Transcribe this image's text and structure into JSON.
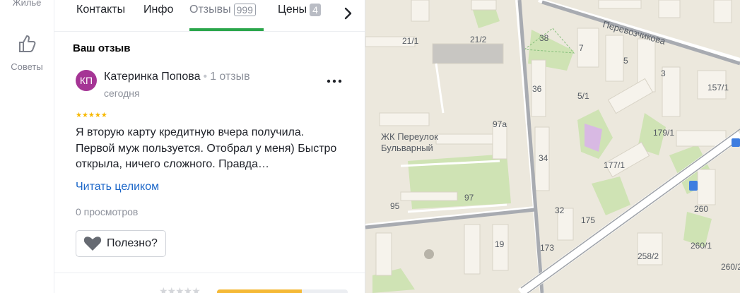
{
  "rail": {
    "items": [
      {
        "label": "Жилье",
        "icon": "home-icon"
      },
      {
        "label": "Советы",
        "icon": "thumbs-up-icon"
      }
    ]
  },
  "tabs": {
    "items": [
      {
        "label": "Контакты"
      },
      {
        "label": "Инфо"
      },
      {
        "label": "Отзывы",
        "count": "999",
        "active": true
      },
      {
        "label": "Цены",
        "count": "4"
      }
    ],
    "active_color": "#2ba64b"
  },
  "review": {
    "section_title": "Ваш отзыв",
    "avatar_initials": "КП",
    "avatar_color": "#a53595",
    "author": "Катеринка Попова",
    "author_reviews": "1 отзыв",
    "date": "сегодня",
    "rating": 5,
    "text": "Я вторую карту кредитную вчера получила. Первой муж пользуется. Отобрал у меня) Быстро открыла, ничего сложного. Правда…",
    "read_more": "Читать целиком",
    "views": "0 просмотров",
    "helpful_label": "Полезно?"
  },
  "map": {
    "streets": [
      "Перевозчикова"
    ],
    "places": [
      "ЖК Переулок",
      "Бульварный"
    ],
    "house_numbers": [
      "21/1",
      "21/2",
      "38",
      "7",
      "5",
      "3",
      "157/1",
      "36",
      "5/1",
      "97а",
      "179/1",
      "34",
      "177/1",
      "97",
      "95",
      "32",
      "175",
      "260",
      "19",
      "173",
      "258/2",
      "260/1",
      "260/2"
    ]
  }
}
